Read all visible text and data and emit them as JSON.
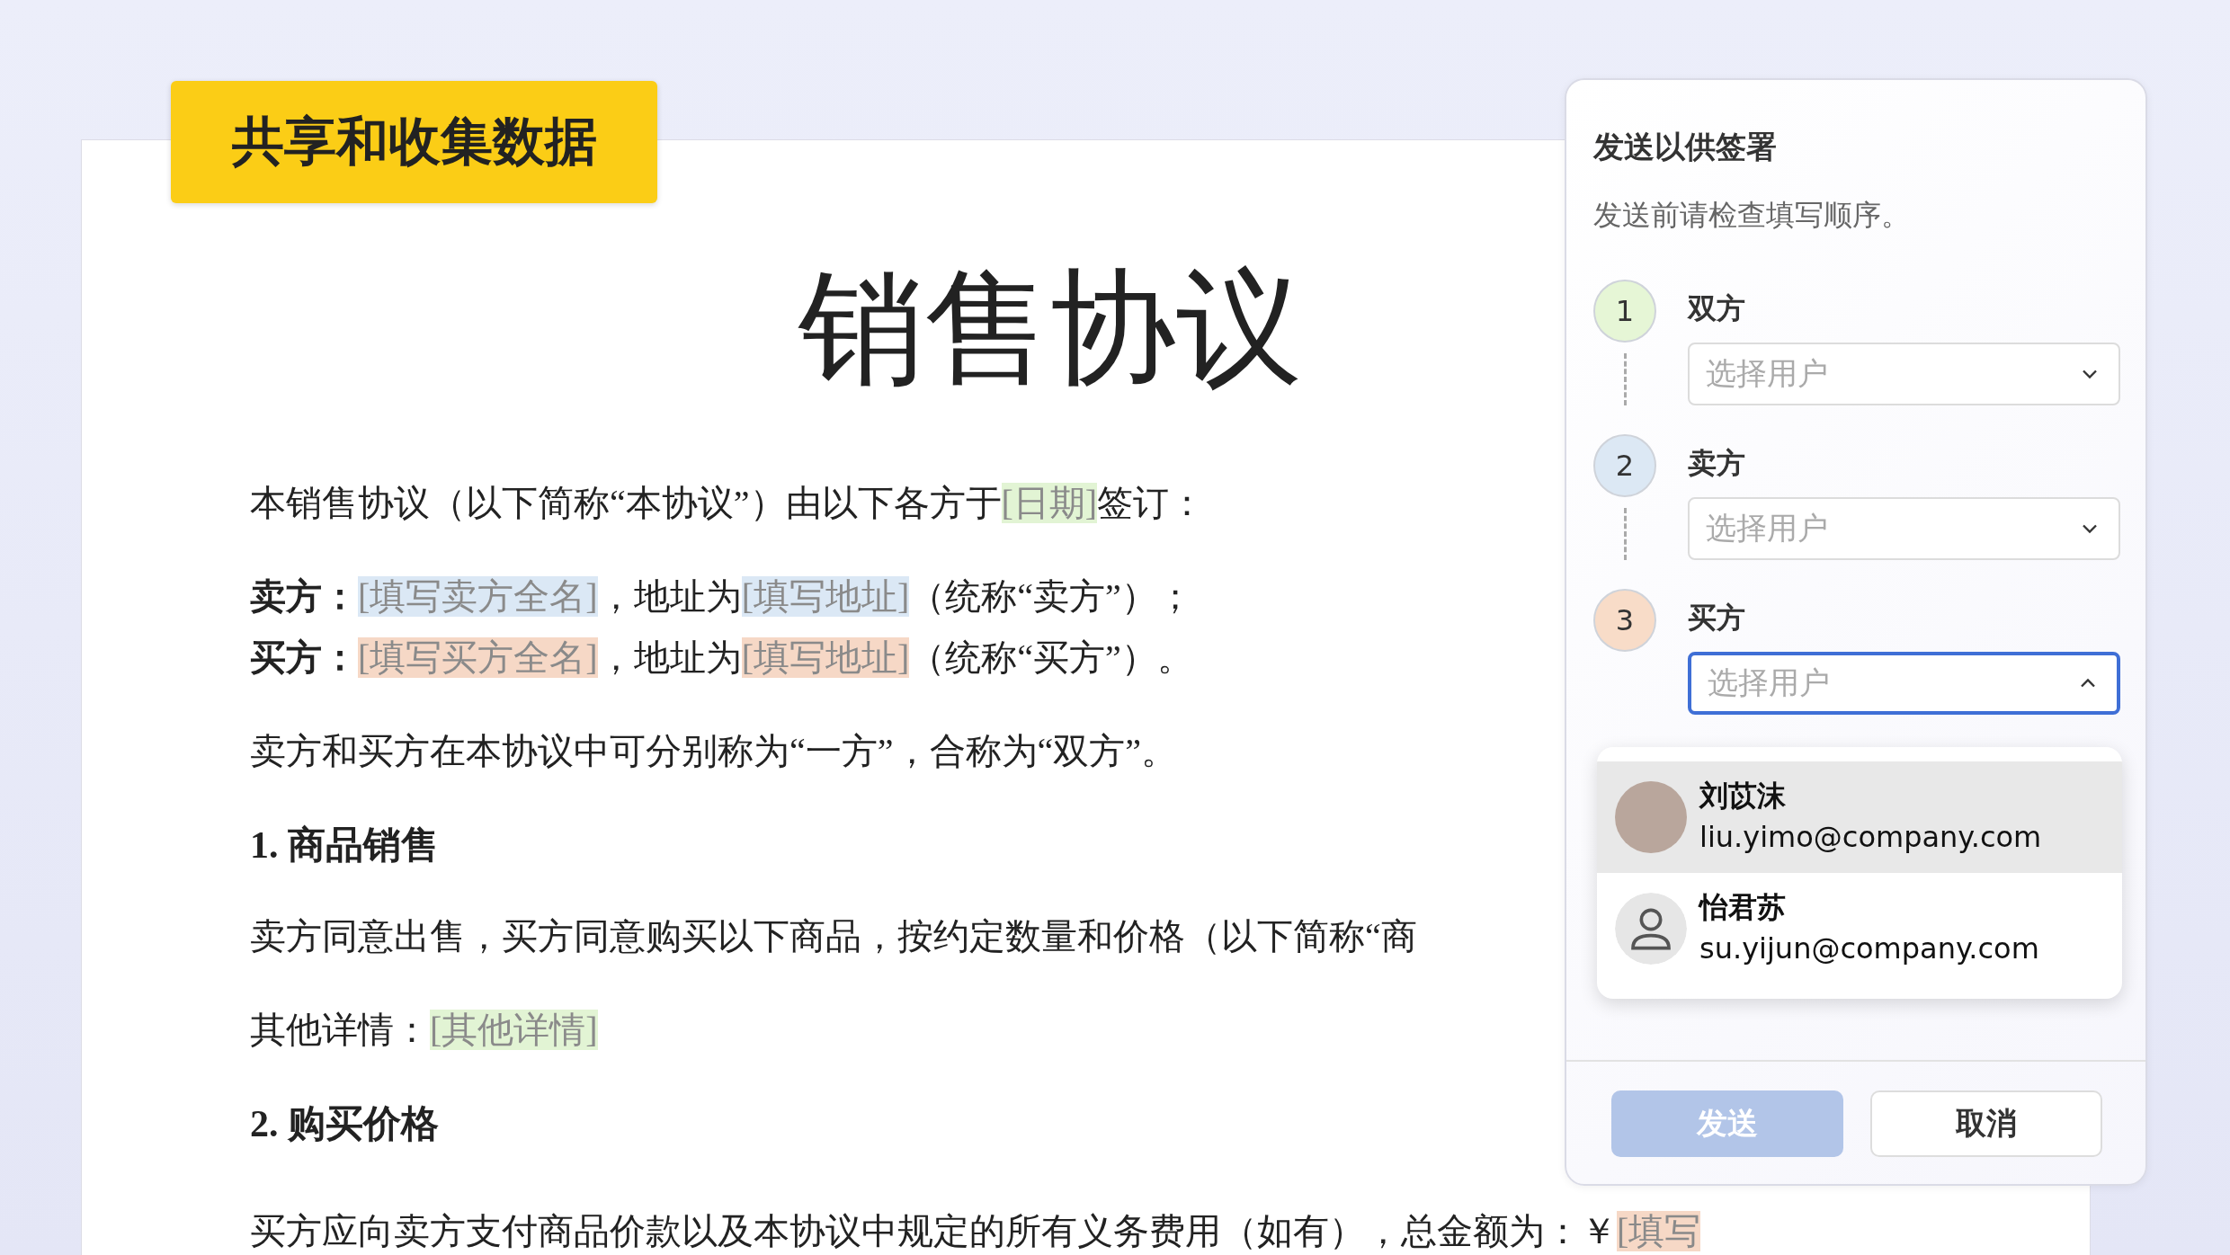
{
  "badge": {
    "label": "共享和收集数据"
  },
  "document": {
    "title": "销售协议",
    "blocks": [
      {
        "kind": "para",
        "segments": [
          {
            "kind": "plain",
            "text": "本销售协议（以下简称“本协议”）由以下各方于"
          },
          {
            "kind": "field",
            "text": "[日期]",
            "color": "#e2f4d4"
          },
          {
            "kind": "plain",
            "text": "签订："
          }
        ]
      },
      {
        "kind": "tight",
        "segments": [
          {
            "kind": "bold",
            "text": "卖方："
          },
          {
            "kind": "field",
            "text": "[填写卖方全名]",
            "color": "#dbe8f5"
          },
          {
            "kind": "plain",
            "text": "，地址为"
          },
          {
            "kind": "field",
            "text": "[填写地址]",
            "color": "#dbe8f5"
          },
          {
            "kind": "plain",
            "text": "（统称“卖方”）；"
          }
        ]
      },
      {
        "kind": "para",
        "segments": [
          {
            "kind": "bold",
            "text": "买方："
          },
          {
            "kind": "field",
            "text": "[填写买方全名]",
            "color": "#f6d8c6"
          },
          {
            "kind": "plain",
            "text": "，地址为"
          },
          {
            "kind": "field",
            "text": "[填写地址]",
            "color": "#f6d8c6"
          },
          {
            "kind": "plain",
            "text": "（统称“买方”）。"
          }
        ]
      },
      {
        "kind": "para",
        "segments": [
          {
            "kind": "plain",
            "text": "卖方和买方在本协议中可分别称为“一方”，合称为“双方”。"
          }
        ]
      },
      {
        "kind": "heading",
        "segments": [
          {
            "kind": "bold",
            "text": "1. 商品销售"
          }
        ]
      },
      {
        "kind": "para",
        "segments": [
          {
            "kind": "plain",
            "text": "卖方同意出售，买方同意购买以下商品，按约定数量和价格（以下简称“商"
          }
        ]
      },
      {
        "kind": "para",
        "segments": [
          {
            "kind": "plain",
            "text": "其他详情："
          },
          {
            "kind": "field",
            "text": "[其他详情]",
            "color": "#e2f4d4"
          }
        ]
      },
      {
        "kind": "heading",
        "segments": [
          {
            "kind": "bold",
            "text": "2. 购买价格"
          }
        ]
      },
      {
        "kind": "para",
        "segments": [
          {
            "kind": "plain",
            "text": "买方应向卖方支付商品价款以及本协议中规定的所有义务费用（如有），总金额为：￥"
          },
          {
            "kind": "field",
            "text": "[填写",
            "color": "#f6d8c6"
          }
        ]
      }
    ]
  },
  "panel": {
    "title": "发送以供签署",
    "subtitle": "发送前请检查填写顺序。",
    "steps": [
      {
        "number": "1",
        "color": "#e6f6d6",
        "label": "双方",
        "placeholder": "选择用户",
        "expanded": false
      },
      {
        "number": "2",
        "color": "#dce8f4",
        "label": "卖方",
        "placeholder": "选择用户",
        "expanded": false
      },
      {
        "number": "3",
        "color": "#f8dcc8",
        "label": "买方",
        "placeholder": "选择用户",
        "expanded": true
      }
    ],
    "options": [
      {
        "name": "刘苡沫",
        "email": "liu.yimo@company.com",
        "kind": "photo",
        "selected": true
      },
      {
        "name": "怡君苏",
        "email": "su.yijun@company.com",
        "kind": "generic",
        "selected": false
      }
    ],
    "buttons": [
      {
        "kind": "primary",
        "label": "发送",
        "disabled": true
      },
      {
        "kind": "secondary",
        "label": "取消",
        "disabled": false
      }
    ]
  }
}
